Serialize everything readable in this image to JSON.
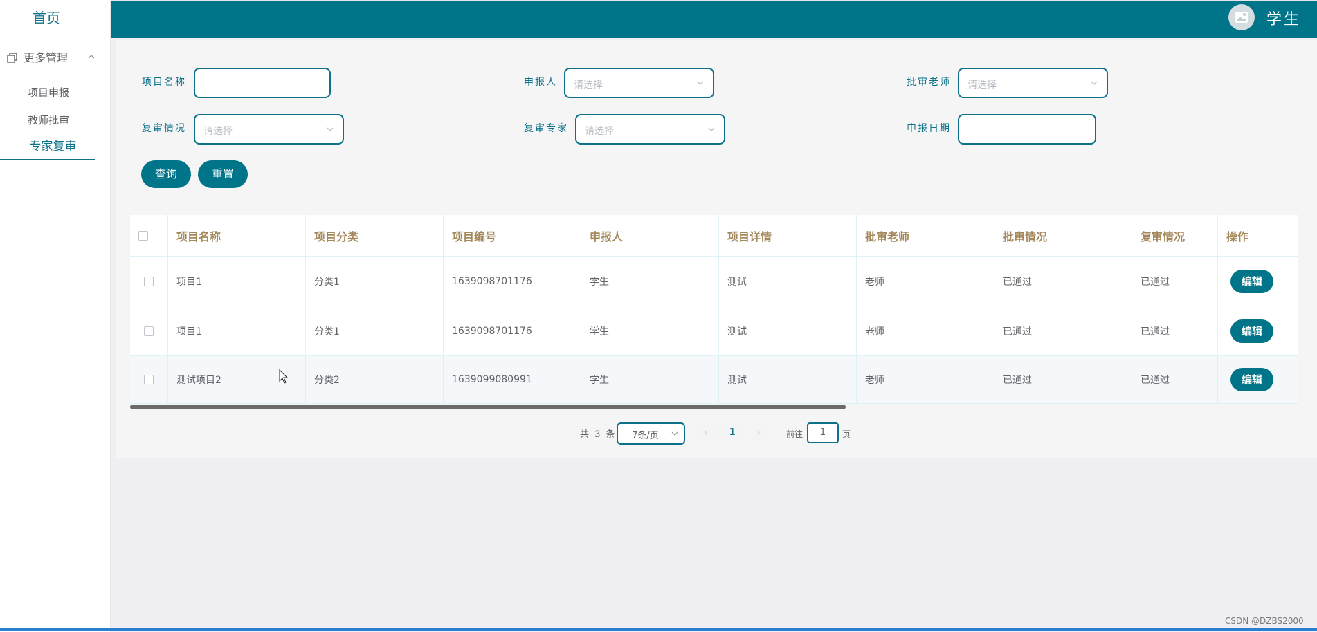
{
  "sidebar": {
    "home": "首页",
    "group_title": "更多管理",
    "items": [
      {
        "label": "项目申报"
      },
      {
        "label": "教师批审"
      },
      {
        "label": "专家复审"
      }
    ]
  },
  "header": {
    "user": "学生"
  },
  "search": {
    "project_name_label": "项目名称",
    "project_name_value": "",
    "applicant_label": "申报人",
    "applicant_placeholder": "请选择",
    "teacher_label": "批审老师",
    "teacher_placeholder": "请选择",
    "review_status_label": "复审情况",
    "review_status_placeholder": "请选择",
    "expert_label": "复审专家",
    "expert_placeholder": "请选择",
    "date_label": "申报日期",
    "date_value": "",
    "query_button": "查询",
    "reset_button": "重置"
  },
  "table": {
    "columns": [
      "项目名称",
      "项目分类",
      "项目编号",
      "申报人",
      "项目详情",
      "批审老师",
      "批审情况",
      "复审情况",
      "操作"
    ],
    "rows": [
      {
        "name": "项目1",
        "category": "分类1",
        "code": "1639098701176",
        "applicant": "学生",
        "detail": "测试",
        "teacher": "老师",
        "approval": "已通过",
        "review": "已通过"
      },
      {
        "name": "项目1",
        "category": "分类1",
        "code": "1639098701176",
        "applicant": "学生",
        "detail": "测试",
        "teacher": "老师",
        "approval": "已通过",
        "review": "已通过"
      },
      {
        "name": "测试项目2",
        "category": "分类2",
        "code": "1639099080991",
        "applicant": "学生",
        "detail": "测试",
        "teacher": "老师",
        "approval": "已通过",
        "review": "已通过"
      }
    ],
    "edit_label": "编辑"
  },
  "pagination": {
    "total": "共 3 条",
    "page_size": "7条/页",
    "prev": "‹",
    "current": "1",
    "next": "›",
    "goto": "前往",
    "jump_value": "1",
    "page_unit": "页"
  },
  "watermark": "CSDN @DZBS2000"
}
